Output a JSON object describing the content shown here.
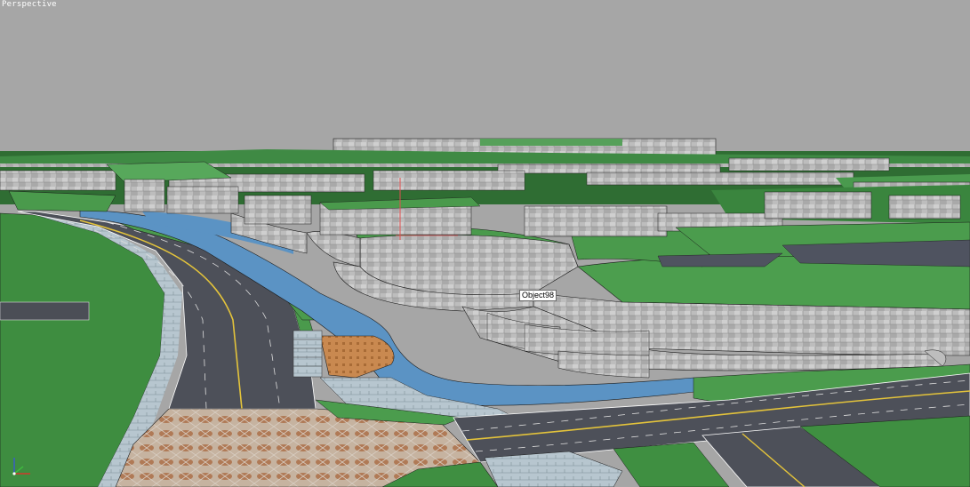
{
  "viewport": {
    "label": "Perspective",
    "background": "#a6a6a6"
  },
  "tooltip": {
    "text": "Object98"
  },
  "scene": {
    "colors": {
      "grass": "#3d8c3e",
      "grass_light": "#5aa85a",
      "water": "#5b93c4",
      "asphalt": "#4c4f58",
      "stone_wall": "#b9b9b9",
      "paving": "#b99f84",
      "wood_deck": "#c78a4c",
      "lane_marking": "#e2c23a"
    }
  },
  "axis_gizmo": {
    "x_axis_color": "#d23a2a",
    "y_axis_color": "#3fbf3f",
    "z_axis_color": "#3a5ad0",
    "icon": "axis-tripod-icon"
  }
}
